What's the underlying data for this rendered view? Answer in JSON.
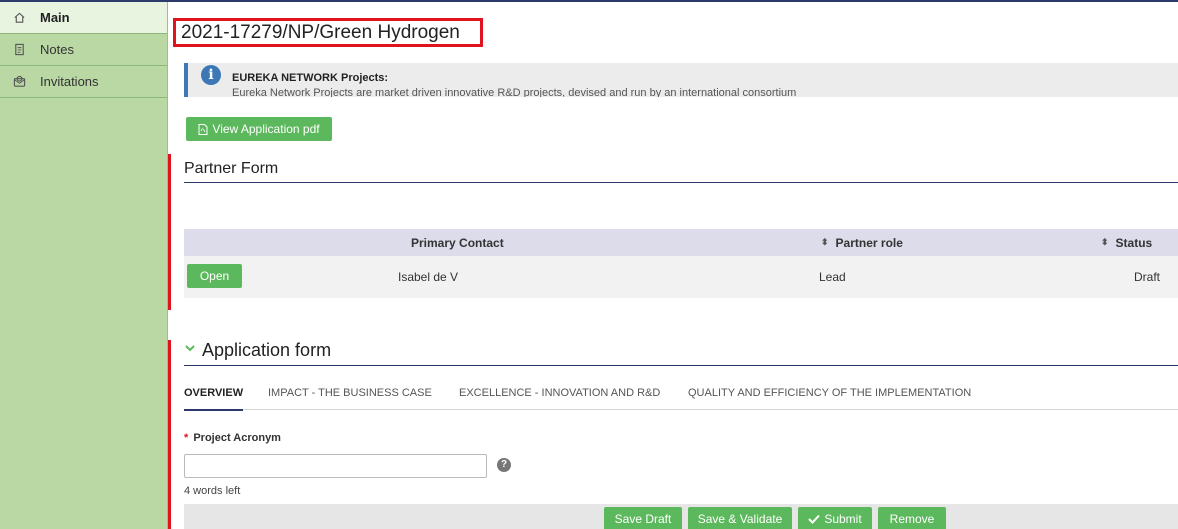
{
  "sidebar": {
    "items": [
      {
        "label": "Main",
        "icon": "home-icon",
        "active": true
      },
      {
        "label": "Notes",
        "icon": "document-icon",
        "active": false
      },
      {
        "label": "Invitations",
        "icon": "invitation-icon",
        "active": false
      }
    ]
  },
  "header": {
    "title": "2021-17279/NP/Green Hydrogen"
  },
  "info": {
    "title": "EUREKA NETWORK Projects:",
    "text": "Eureka Network Projects are market driven innovative R&D projects, devised and run by an international consortium"
  },
  "actions": {
    "view_pdf_label": "View Application pdf"
  },
  "partner_form": {
    "title": "Partner Form",
    "columns": [
      "Primary Contact",
      "Partner role",
      "Status"
    ],
    "rows": [
      {
        "open_label": "Open",
        "primary_contact": "Isabel de V",
        "partner_role": "Lead",
        "status": "Draft"
      }
    ]
  },
  "application_form": {
    "title": "Application form",
    "tabs": [
      {
        "label": "OVERVIEW",
        "active": true
      },
      {
        "label": "IMPACT - THE BUSINESS CASE",
        "active": false
      },
      {
        "label": "EXCELLENCE - INNOVATION AND R&D",
        "active": false
      },
      {
        "label": "QUALITY AND EFFICIENCY OF THE IMPLEMENTATION",
        "active": false
      }
    ],
    "field": {
      "required_mark": "*",
      "label": "Project Acronym",
      "value": "",
      "help": "?",
      "words_left": "4 words left"
    }
  },
  "footer": {
    "save_draft": "Save Draft",
    "save_validate": "Save & Validate",
    "submit": "Submit",
    "remove": "Remove"
  },
  "colors": {
    "sidebar_bg": "#b9d8a3",
    "accent_green": "#5cb85c",
    "highlight_red": "#e0141e",
    "navy": "#2b3a6b",
    "info_blue": "#3c78b6"
  }
}
